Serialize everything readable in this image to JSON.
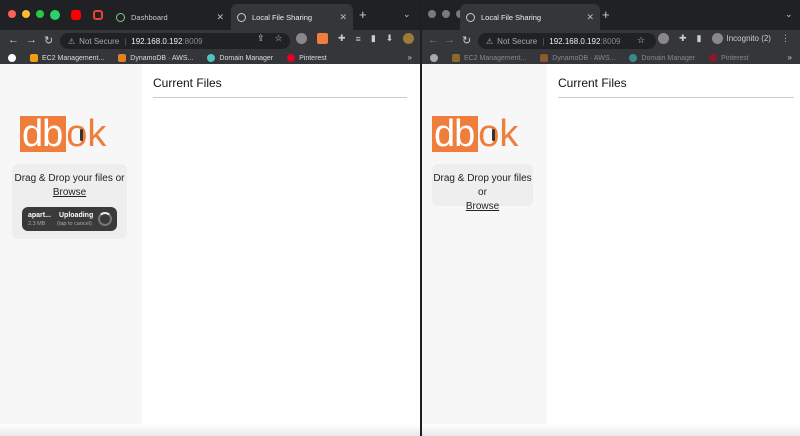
{
  "colors": {
    "accent": "#ef7d3c",
    "tab_bg": "#202124",
    "toolbar_bg": "#35363a",
    "sidebar_bg": "#f7f7f7"
  },
  "left": {
    "tabs": [
      {
        "label": "",
        "icon": "whatsapp-icon"
      },
      {
        "label": "",
        "icon": "youtube-icon"
      },
      {
        "label": "",
        "icon": "gmail-icon"
      },
      {
        "label": "Dashboard",
        "icon": "dashboard-icon"
      },
      {
        "label": "Local File Sharing",
        "icon": "globe-icon",
        "active": true
      }
    ],
    "omnibox": {
      "security": "Not Secure",
      "host": "192.168.0.192",
      "port": ":8009"
    },
    "bookmarks": [
      "EC2 Management...",
      "DynamoDB · AWS...",
      "Domain Manager",
      "Pinterest"
    ],
    "page": {
      "logo_left": "db",
      "logo_right": "ok",
      "dropzone_text": "Drag & Drop your files or",
      "browse_label": "Browse",
      "upload": {
        "name": "apart...",
        "size": "2.3 MB",
        "status": "Uploading",
        "hint": "tap to cancel"
      },
      "heading": "Current Files"
    }
  },
  "right": {
    "tabs": [
      {
        "label": "Local File Sharing",
        "icon": "globe-icon",
        "active": true
      }
    ],
    "omnibox": {
      "security": "Not Secure",
      "host": "192.168.0.192",
      "port": ":8009"
    },
    "incognito": "Incognito (2)",
    "bookmarks": [
      "EC2 Management...",
      "DynamoDB · AWS...",
      "Domain Manager",
      "Pinterest"
    ],
    "page": {
      "logo_left": "db",
      "logo_right": "ok",
      "dropzone_text": "Drag & Drop your files or",
      "browse_label": "Browse",
      "heading": "Current Files"
    }
  }
}
